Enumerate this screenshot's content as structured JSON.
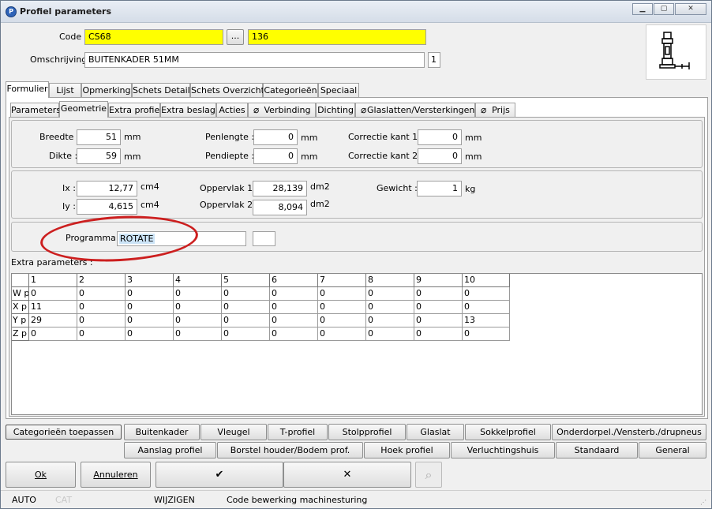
{
  "window": {
    "title": "Profiel parameters"
  },
  "header": {
    "code_label": "Code :",
    "code_value": "CS68",
    "browse_label": "...",
    "code2_value": "136",
    "desc_label": "Omschrijving :",
    "desc_value": "BUITENKADER 51MM",
    "desc_count": "1"
  },
  "tabs_main": [
    "Formulier",
    "Lijst",
    "Opmerking",
    "Schets Detail",
    "Schets Overzicht",
    "Categorieën",
    "Speciaal"
  ],
  "tabs_sub": [
    "Parameters",
    "Geometrie",
    "Extra profiel",
    "Extra beslag",
    "Acties",
    "Verbinding",
    "Dichting",
    "Glaslatten/Versterkingen",
    "Prijs"
  ],
  "geom": {
    "breedte_label": "Breedte :",
    "breedte": "51",
    "breedte_unit": "mm",
    "dikte_label": "Dikte :",
    "dikte": "59",
    "dikte_unit": "mm",
    "penlengte_label": "Penlengte :",
    "penlengte": "0",
    "penlengte_unit": "mm",
    "pendiepte_label": "Pendiepte :",
    "pendiepte": "0",
    "pendiepte_unit": "mm",
    "corr1_label": "Correctie kant 1 :",
    "corr1": "0",
    "corr1_unit": "mm",
    "corr2_label": "Correctie kant 2 :",
    "corr2": "0",
    "corr2_unit": "mm"
  },
  "props": {
    "ix_label": "Ix :",
    "ix": "12,77",
    "ix_unit": "cm4",
    "iy_label": "Iy :",
    "iy": "4,615",
    "iy_unit": "cm4",
    "opp1_label": "Oppervlak 1:",
    "opp1": "28,139",
    "opp1_unit": "dm2",
    "opp2_label": "Oppervlak 2:",
    "opp2": "8,094",
    "opp2_unit": "dm2",
    "gewicht_label": "Gewicht :",
    "gewicht": "1",
    "gewicht_unit": "kg"
  },
  "programma": {
    "label": "Programma :",
    "value": "ROTATE"
  },
  "extra": {
    "label": "Extra parameters :",
    "columns": [
      "1",
      "2",
      "3",
      "4",
      "5",
      "6",
      "7",
      "8",
      "9",
      "10"
    ],
    "rows": [
      {
        "head": "W p",
        "cells": [
          "0",
          "0",
          "0",
          "0",
          "0",
          "0",
          "0",
          "0",
          "0",
          "0"
        ]
      },
      {
        "head": "X p",
        "cells": [
          "11",
          "0",
          "0",
          "0",
          "0",
          "0",
          "0",
          "0",
          "0",
          "0"
        ]
      },
      {
        "head": "Y p",
        "cells": [
          "29",
          "0",
          "0",
          "0",
          "0",
          "0",
          "0",
          "0",
          "0",
          "13"
        ]
      },
      {
        "head": "Z p",
        "cells": [
          "0",
          "0",
          "0",
          "0",
          "0",
          "0",
          "0",
          "0",
          "0",
          "0"
        ]
      }
    ]
  },
  "cat_buttons": {
    "apply": "Categorieën toepassen",
    "row1": [
      "Buitenkader",
      "Vleugel",
      "T-profiel",
      "Stolpprofiel",
      "Glaslat",
      "Sokkelprofiel",
      "Onderdorpel./Vensterb./drupneus"
    ],
    "row2": [
      "Aanslag profiel",
      "Borstel houder/Bodem prof.",
      "Hoek profiel",
      "Verluchtingshuis",
      "Standaard",
      "General"
    ]
  },
  "actions": {
    "ok": "Ok",
    "cancel": "Annuleren",
    "check": "✔",
    "cross": "✕",
    "binoculars": "⌕"
  },
  "status": {
    "mode": "AUTO",
    "cat": "CAT",
    "state": "WIJZIGEN",
    "info": "Code bewerking machinesturing"
  },
  "colors": {
    "highlight": "#ffff00",
    "circle": "#cc1f1f",
    "selection": "#cce4f7"
  }
}
